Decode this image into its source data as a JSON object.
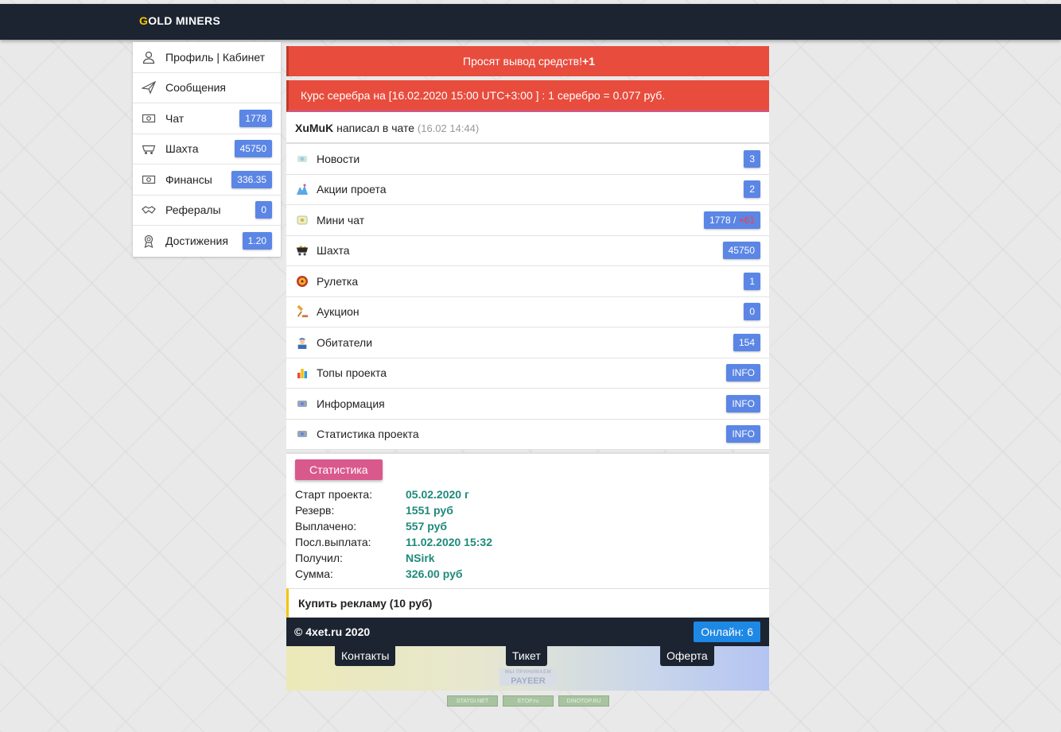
{
  "header": {
    "logo_first": "G",
    "logo_rest": "OLD MINERS"
  },
  "sidebar": {
    "items": [
      {
        "label": "Профиль | Кабинет",
        "icon": "user-icon",
        "badge": null
      },
      {
        "label": "Сообщения",
        "icon": "paper-plane-icon",
        "badge": null
      },
      {
        "label": "Чат",
        "icon": "money-icon",
        "badge": "1778"
      },
      {
        "label": "Шахта",
        "icon": "mine-cart-icon",
        "badge": "45750"
      },
      {
        "label": "Финансы",
        "icon": "money-icon",
        "badge": "336.35"
      },
      {
        "label": "Рефералы",
        "icon": "handshake-icon",
        "badge": "0"
      },
      {
        "label": "Достижения",
        "icon": "award-icon",
        "badge": "1.20"
      }
    ]
  },
  "alerts": {
    "withdraw_text": "Просят вывод средств!",
    "withdraw_count": "+1",
    "rate_text": "Курс серебра на [16.02.2020 15:00 UTC+3:00 ] : 1 серебро = 0.077 руб."
  },
  "chat_line": {
    "user": "XuMuK",
    "action": " написал в чате ",
    "time": "(16.02 14:44)"
  },
  "menu": {
    "items": [
      {
        "label": "Новости",
        "icon": "news-icon",
        "badge": "3"
      },
      {
        "label": "Акции проета",
        "icon": "promo-icon",
        "badge": "2"
      },
      {
        "label": "Мини чат",
        "icon": "mini-chat-icon",
        "badge": "1778 / ",
        "badge_extra": "+61"
      },
      {
        "label": "Шахта",
        "icon": "mine-cart-icon",
        "badge": "45750"
      },
      {
        "label": "Рулетка",
        "icon": "roulette-icon",
        "badge": "1"
      },
      {
        "label": "Аукцион",
        "icon": "auction-hammer-icon",
        "badge": "0"
      },
      {
        "label": "Обитатели",
        "icon": "miner-icon",
        "badge": "154"
      },
      {
        "label": "Топы проекта",
        "icon": "tops-icon",
        "badge": "INFO"
      },
      {
        "label": "Информация",
        "icon": "info-icon",
        "badge": "INFO"
      },
      {
        "label": "Статистика проекта",
        "icon": "stats-icon",
        "badge": "INFO"
      }
    ]
  },
  "stats": {
    "button": "Статистика",
    "rows": [
      {
        "key": "Старт проекта:",
        "value": "05.02.2020 г"
      },
      {
        "key": "Резерв:",
        "value": "1551 руб"
      },
      {
        "key": "Выплачено:",
        "value": "557 руб"
      },
      {
        "key": "Посл.выплата:",
        "value": "11.02.2020 15:32"
      },
      {
        "key": "Получил:",
        "value": "NSirk"
      },
      {
        "key": "Сумма:",
        "value": "326.00 руб"
      }
    ]
  },
  "ad": {
    "label": "Купить рекламу (10 руб)"
  },
  "footer": {
    "copyright": "© 4xet.ru 2020",
    "online": "Онлайн: 6",
    "links": [
      "Контакты",
      "Тикет",
      "Оферта"
    ]
  },
  "payeer": {
    "caption": "МЫ ПРИНИМАЕМ",
    "brand": "PAYEER"
  },
  "counters": [
    "STATGI.NET",
    "ETOP.ru",
    "DINOTOP.RU"
  ],
  "colors": {
    "topbar": "#1c2431",
    "badge": "#5b86e5",
    "alert": "#e84c3d",
    "stat_value": "#1e8a7a",
    "stats_button": "#d9598c",
    "online": "#1e88e5",
    "logo_accent": "#f5c400"
  }
}
